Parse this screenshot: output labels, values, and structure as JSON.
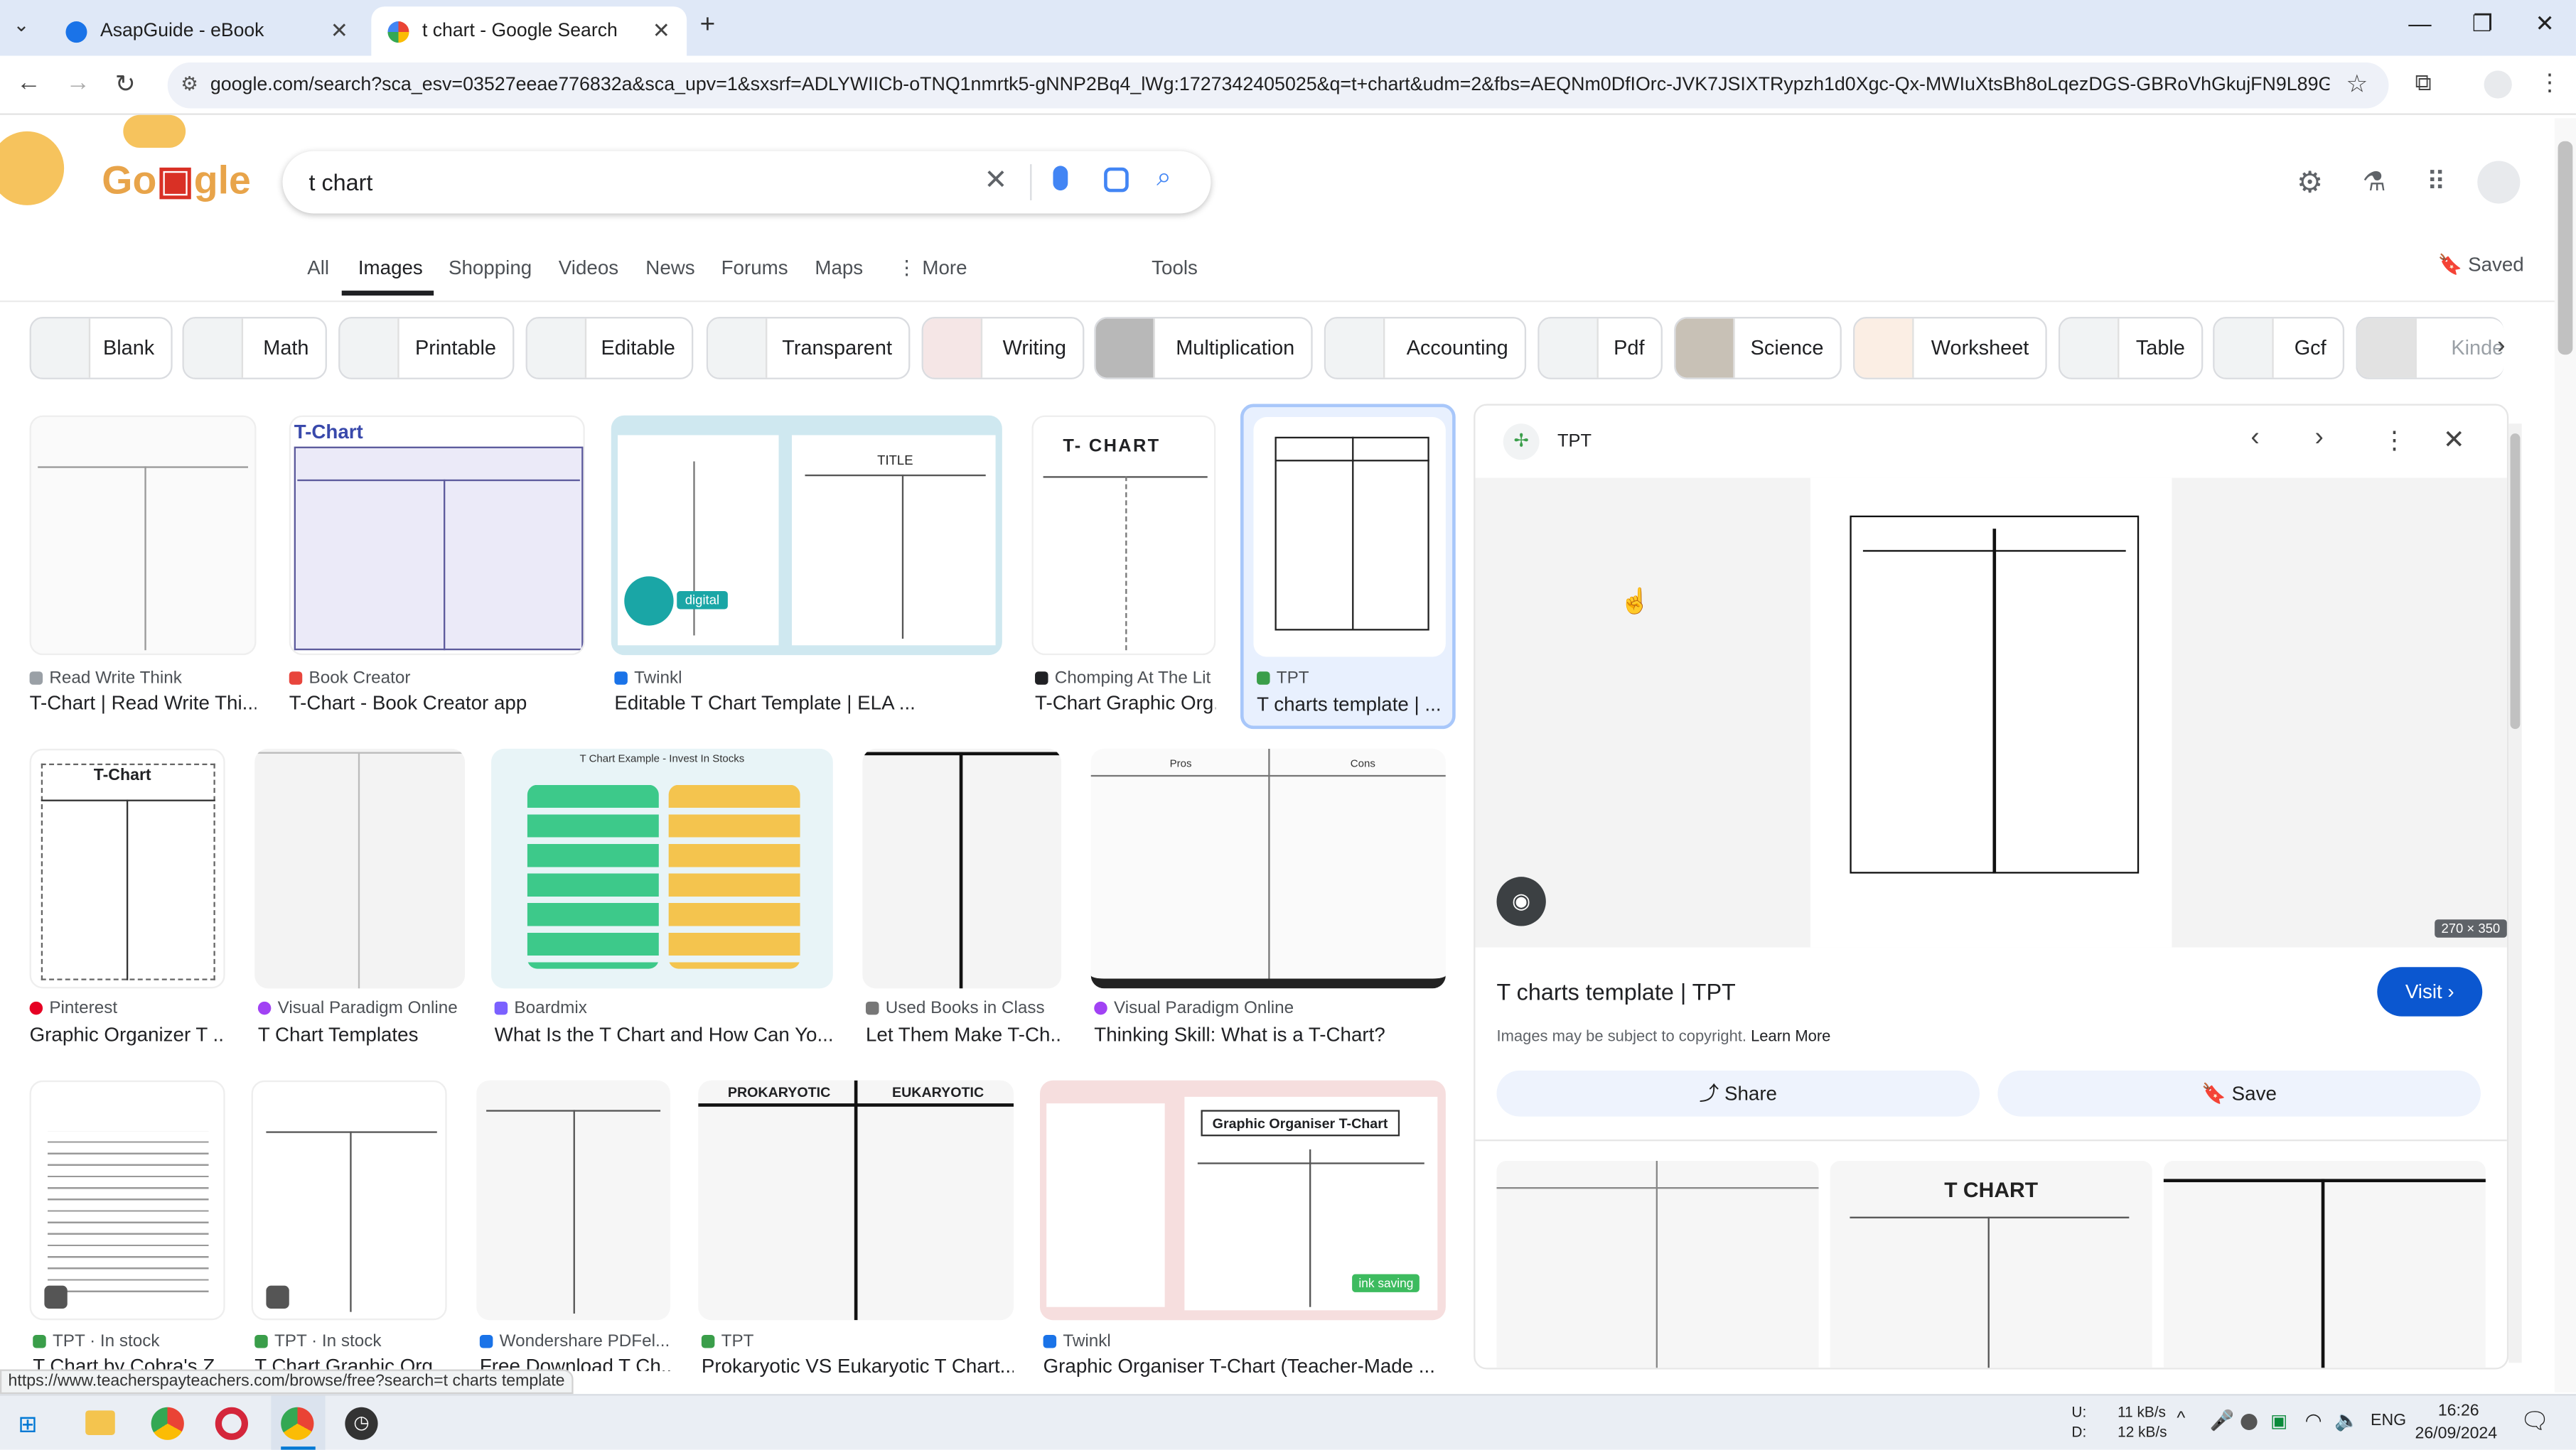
{
  "browser": {
    "tabs": [
      {
        "title": "AsapGuide - eBook"
      },
      {
        "title": "t chart - Google Search"
      }
    ],
    "url": "google.com/search?sca_esv=03527eeae776832a&sca_upv=1&sxsrf=ADLYWIICb-oTNQ1nmrtk5-gNNP2Bq4_lWg:1727342405025&q=t+chart&udm=2&fbs=AEQNm0DfIOrc-JVK7JSIXTRypzh1d0Xgc-Qx-MWIuXtsBh8oLqezDGS-GBRoVhGkujFN9L89G8OpQ_..."
  },
  "search": {
    "query": "t chart",
    "saved_label": "Saved"
  },
  "nav_tabs": [
    "All",
    "Images",
    "Shopping",
    "Videos",
    "News",
    "Forums",
    "Maps",
    "More",
    "Tools"
  ],
  "chips": [
    "Blank",
    "Math",
    "Printable",
    "Editable",
    "Transparent",
    "Writing",
    "Multiplication",
    "Accounting",
    "Pdf",
    "Science",
    "Worksheet",
    "Table",
    "Gcf",
    "Kinde"
  ],
  "results": [
    {
      "source": "Read Write Think",
      "title": "T-Chart | Read Write Thi..."
    },
    {
      "source": "Book Creator",
      "title": "T-Chart - Book Creator app",
      "img_text": "T-Chart"
    },
    {
      "source": "Twinkl",
      "title": "Editable T Chart Template | ELA ...",
      "img_text": "TITLE",
      "badge": "digital"
    },
    {
      "source": "Chomping At The Lit",
      "title": "T-Chart Graphic Org...",
      "img_text": "T- CHART"
    },
    {
      "source": "TPT",
      "title": "T charts template | ..."
    },
    {
      "source": "Pinterest",
      "title": "Graphic Organizer T ...",
      "img_text": "T-Chart"
    },
    {
      "source": "Visual Paradigm Online",
      "title": "T Chart Templates"
    },
    {
      "source": "Boardmix",
      "title": "What Is the T Chart and How Can Yo...",
      "img_text": "T Chart Example - Invest In Stocks"
    },
    {
      "source": "Used Books in Class",
      "title": "Let Them Make T-Ch..."
    },
    {
      "source": "Visual Paradigm Online",
      "title": "Thinking Skill: What is a T-Chart?",
      "img_text": [
        "Pros",
        "Cons"
      ]
    },
    {
      "source": "TPT · In stock",
      "title": "T Chart by Cobra's Z..."
    },
    {
      "source": "TPT · In stock",
      "title": "T Chart Graphic Org..."
    },
    {
      "source": "Wondershare PDFel...",
      "title": "Free Download T Ch..."
    },
    {
      "source": "TPT",
      "title": "Prokaryotic VS Eukaryotic T Chart...",
      "img_text": [
        "PROKARYOTIC",
        "EUKARYOTIC"
      ]
    },
    {
      "source": "Twinkl",
      "title": "Graphic Organiser T-Chart (Teacher-Made ...",
      "img_text": "Graphic Organiser T-Chart",
      "badge": "ink saving"
    }
  ],
  "panel": {
    "source": "TPT",
    "title": "T charts template | TPT",
    "visit_label": "Visit",
    "copyright": "Images may be subject to copyright.",
    "learn_more": "Learn More",
    "share_label": "Share",
    "save_label": "Save",
    "dimensions": "270 × 350",
    "related_text": "T CHART"
  },
  "status_url": "https://www.teacherspayteachers.com/browse/free?search=t charts template",
  "taskbar": {
    "net_up": "11 kB/s",
    "net_down": "12 kB/s",
    "net_u": "U:",
    "net_d": "D:",
    "lang": "ENG",
    "time": "16:26",
    "date": "26/09/2024"
  },
  "colors": {
    "accent": "#0b57d0",
    "tabstrip": "#dfe8f7",
    "selected_border": "#a8c7fa"
  }
}
